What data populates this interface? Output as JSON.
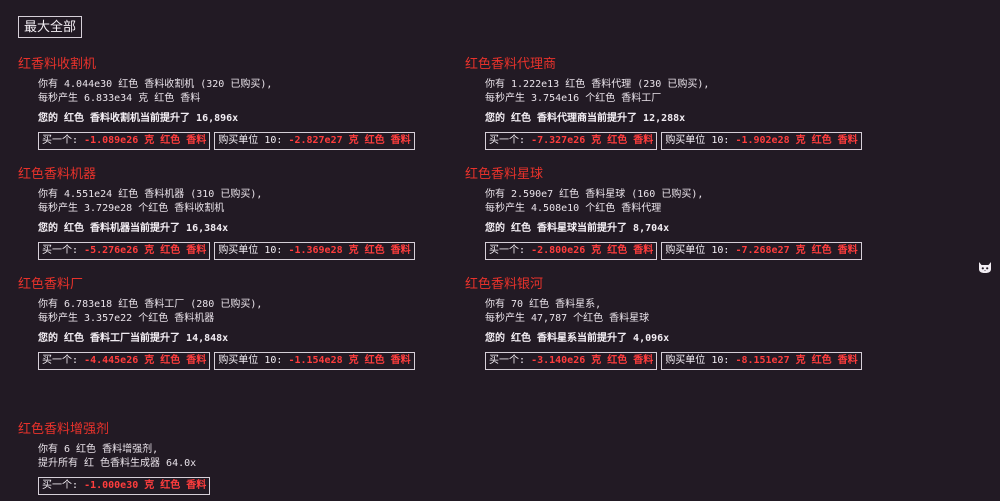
{
  "max_all_label": "最大全部",
  "generators": [
    {
      "title": "红香料收割机",
      "line1": "你有 4.044e30 红色 香料收割机 (320 已购买),",
      "line2": "每秒产生 6.833e34 克 红色 香料",
      "boost": "您的 红色 香料收割机当前提升了 16,896x",
      "buy1_label": "买一个:",
      "buy1_cost": "-1.089e26 克 红色 香料",
      "buy10_label": "购买单位 10:",
      "buy10_cost": "-2.827e27 克 红色 香料"
    },
    {
      "title": "红色香料代理商",
      "line1": "你有 1.222e13 红色 香料代理 (230 已购买),",
      "line2": "每秒产生 3.754e16 个红色 香料工厂",
      "boost": "您的 红色 香料代理商当前提升了 12,288x",
      "buy1_label": "买一个:",
      "buy1_cost": "-7.327e26 克 红色 香料",
      "buy10_label": "购买单位 10:",
      "buy10_cost": "-1.902e28 克 红色 香料"
    },
    {
      "title": "红色香料机器",
      "line1": "你有 4.551e24 红色 香料机器 (310 已购买),",
      "line2": "每秒产生 3.729e28 个红色 香料收割机",
      "boost": "您的 红色 香料机器当前提升了 16,384x",
      "buy1_label": "买一个:",
      "buy1_cost": "-5.276e26 克 红色 香料",
      "buy10_label": "购买单位 10:",
      "buy10_cost": "-1.369e28 克 红色 香料"
    },
    {
      "title": "红色香料星球",
      "line1": "你有 2.590e7 红色 香料星球 (160 已购买),",
      "line2": "每秒产生 4.508e10 个红色 香料代理",
      "boost": "您的 红色 香料星球当前提升了 8,704x",
      "buy1_label": "买一个:",
      "buy1_cost": "-2.800e26 克 红色 香料",
      "buy10_label": "购买单位 10:",
      "buy10_cost": "-7.268e27 克 红色 香料"
    },
    {
      "title": "红色香料厂",
      "line1": "你有 6.783e18 红色 香料工厂 (280 已购买),",
      "line2": "每秒产生 3.357e22 个红色 香料机器",
      "boost": "您的 红色 香料工厂当前提升了 14,848x",
      "buy1_label": "买一个:",
      "buy1_cost": "-4.445e26 克 红色 香料",
      "buy10_label": "购买单位 10:",
      "buy10_cost": "-1.154e28 克 红色 香料"
    },
    {
      "title": "红色香料银河",
      "line1": "你有 70 红色 香料星系,",
      "line2": "每秒产生 47,787 个红色 香料星球",
      "boost": "您的 红色 香料星系当前提升了 4,096x",
      "buy1_label": "买一个:",
      "buy1_cost": "-3.140e26 克 红色 香料",
      "buy10_label": "购买单位 10:",
      "buy10_cost": "-8.151e27 克 红色 香料"
    }
  ],
  "booster": {
    "title": "红色香料增强剂",
    "line1": "你有 6 红色 香料增强剂,",
    "line2": "提升所有 红 色香料生成器 64.0x",
    "buy1_label": "买一个:",
    "buy1_cost": "-1.000e30 克 红色 香料"
  },
  "colors": {
    "background": "#221a24",
    "title_red": "#e8322b",
    "cost_red": "#ff3d3d",
    "text": "#e9e3ea"
  },
  "icons": {
    "side_icon": "cat-icon"
  }
}
